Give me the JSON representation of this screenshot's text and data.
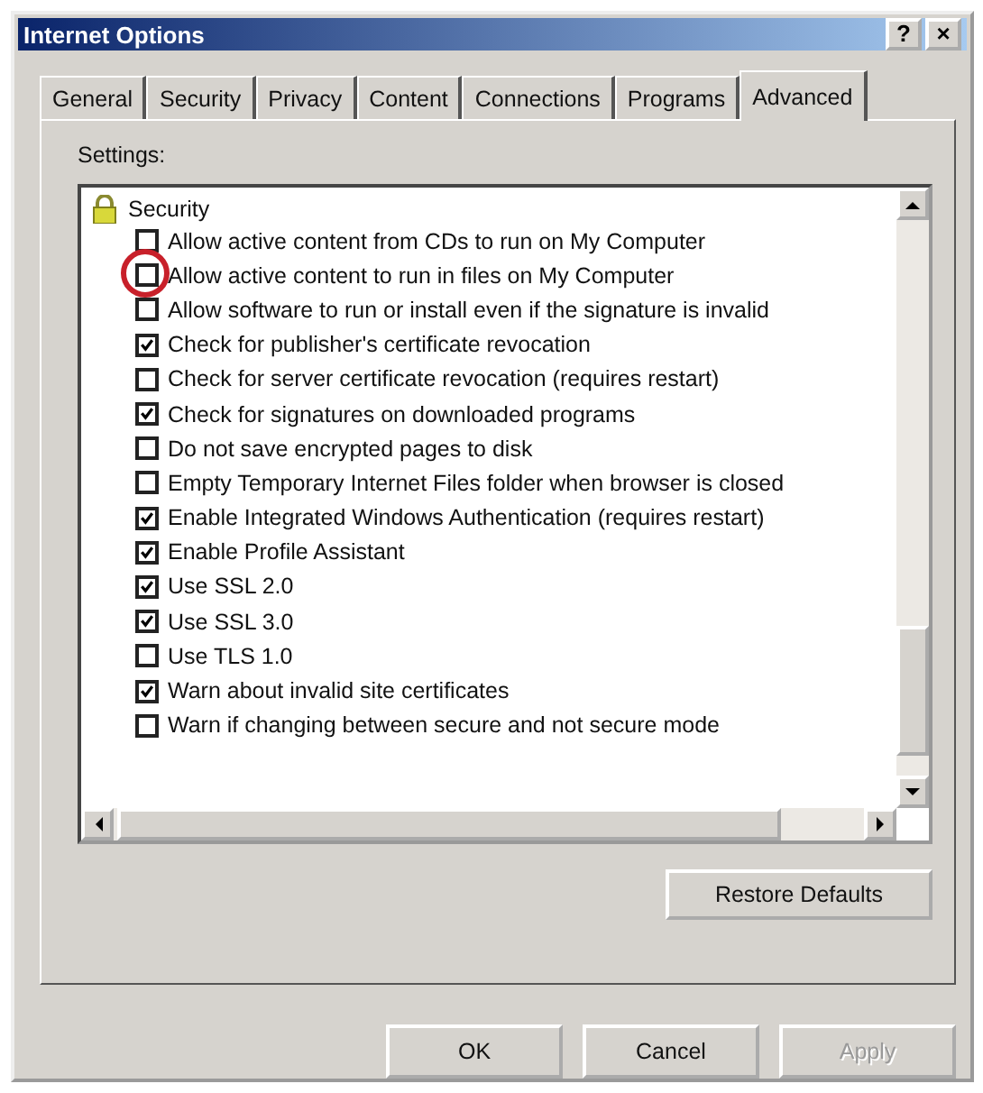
{
  "window": {
    "title": "Internet Options",
    "help_button": "?",
    "close_button": "×"
  },
  "tabs": [
    {
      "label": "General",
      "selected": false
    },
    {
      "label": "Security",
      "selected": false
    },
    {
      "label": "Privacy",
      "selected": false
    },
    {
      "label": "Content",
      "selected": false
    },
    {
      "label": "Connections",
      "selected": false
    },
    {
      "label": "Programs",
      "selected": false
    },
    {
      "label": "Advanced",
      "selected": true
    }
  ],
  "settings_label": "Settings:",
  "group": {
    "label": "Security",
    "items": [
      {
        "label": "Allow active content from CDs to run on My Computer",
        "checked": false,
        "circled": false
      },
      {
        "label": "Allow active content to run in files on My Computer",
        "checked": false,
        "circled": true
      },
      {
        "label": "Allow software to run or install even if the signature is invalid",
        "checked": false,
        "circled": false
      },
      {
        "label": "Check for publisher's certificate revocation",
        "checked": true,
        "circled": false
      },
      {
        "label": "Check for server certificate revocation (requires restart)",
        "checked": false,
        "circled": false
      },
      {
        "label": "Check for signatures on downloaded programs",
        "checked": true,
        "circled": false
      },
      {
        "label": "Do not save encrypted pages to disk",
        "checked": false,
        "circled": false
      },
      {
        "label": "Empty Temporary Internet Files folder when browser is closed",
        "checked": false,
        "circled": false
      },
      {
        "label": "Enable Integrated Windows Authentication (requires restart)",
        "checked": true,
        "circled": false
      },
      {
        "label": "Enable Profile Assistant",
        "checked": true,
        "circled": false
      },
      {
        "label": "Use SSL 2.0",
        "checked": true,
        "circled": false
      },
      {
        "label": "Use SSL 3.0",
        "checked": true,
        "circled": false
      },
      {
        "label": "Use TLS 1.0",
        "checked": false,
        "circled": false
      },
      {
        "label": "Warn about invalid site certificates",
        "checked": true,
        "circled": false
      },
      {
        "label": "Warn if changing between secure and not secure mode",
        "checked": false,
        "circled": false
      }
    ]
  },
  "restore_button": "Restore Defaults",
  "buttons": [
    {
      "label": "OK",
      "disabled": false
    },
    {
      "label": "Cancel",
      "disabled": false
    },
    {
      "label": "Apply",
      "disabled": true
    }
  ]
}
